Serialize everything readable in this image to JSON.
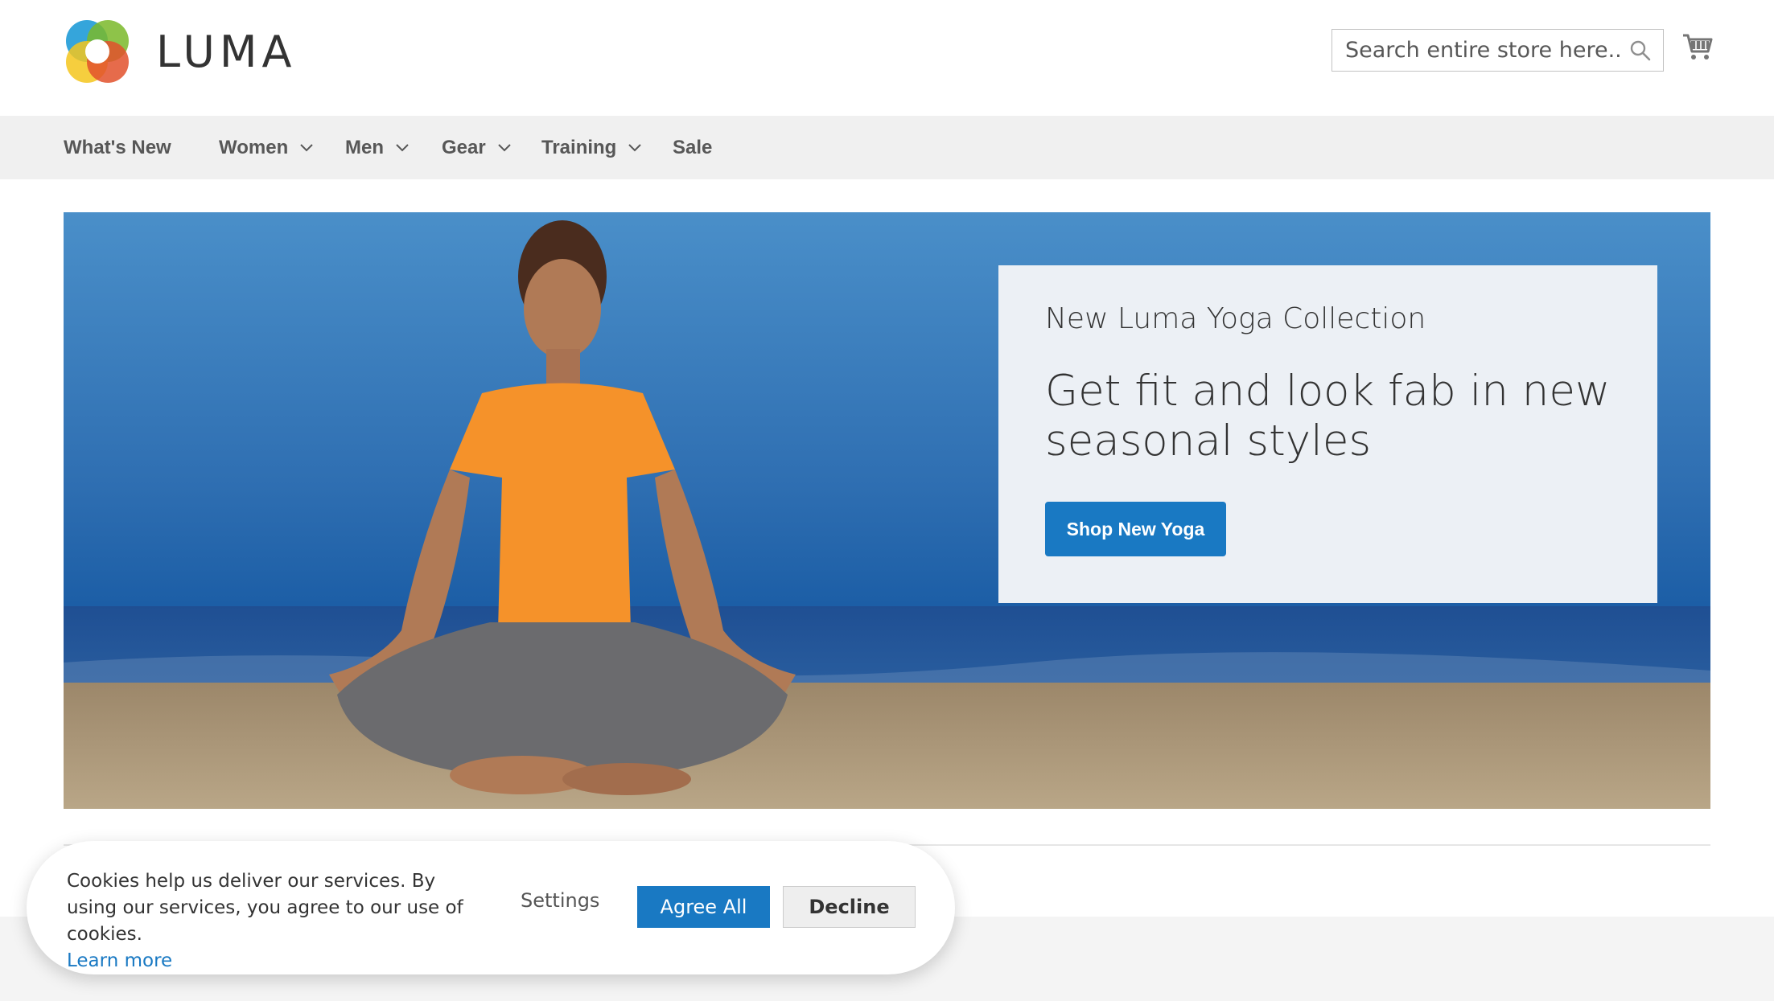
{
  "header": {
    "logo_text": "LUMA",
    "search_placeholder": "Search entire store here...",
    "cart_icon": "shopping-cart-icon",
    "search_icon": "magnifier-icon"
  },
  "nav": {
    "items": [
      {
        "label": "What's New",
        "has_dropdown": false
      },
      {
        "label": "Women",
        "has_dropdown": true
      },
      {
        "label": "Men",
        "has_dropdown": true
      },
      {
        "label": "Gear",
        "has_dropdown": true
      },
      {
        "label": "Training",
        "has_dropdown": true
      },
      {
        "label": "Sale",
        "has_dropdown": false
      }
    ]
  },
  "hero": {
    "subtitle": "New Luma Yoga Collection",
    "title": "Get fit and look fab in new seasonal styles",
    "cta_label": "Shop New Yoga"
  },
  "cookie_banner": {
    "message": "Cookies help us deliver our services. By using our services, you agree to our use of cookies.",
    "learn_more": "Learn more",
    "settings_label": "Settings",
    "agree_label": "Agree All",
    "decline_label": "Decline"
  },
  "colors": {
    "accent": "#1979c3",
    "nav_bg": "#f0f0f0",
    "promo_bg": "#ecf0f5"
  }
}
